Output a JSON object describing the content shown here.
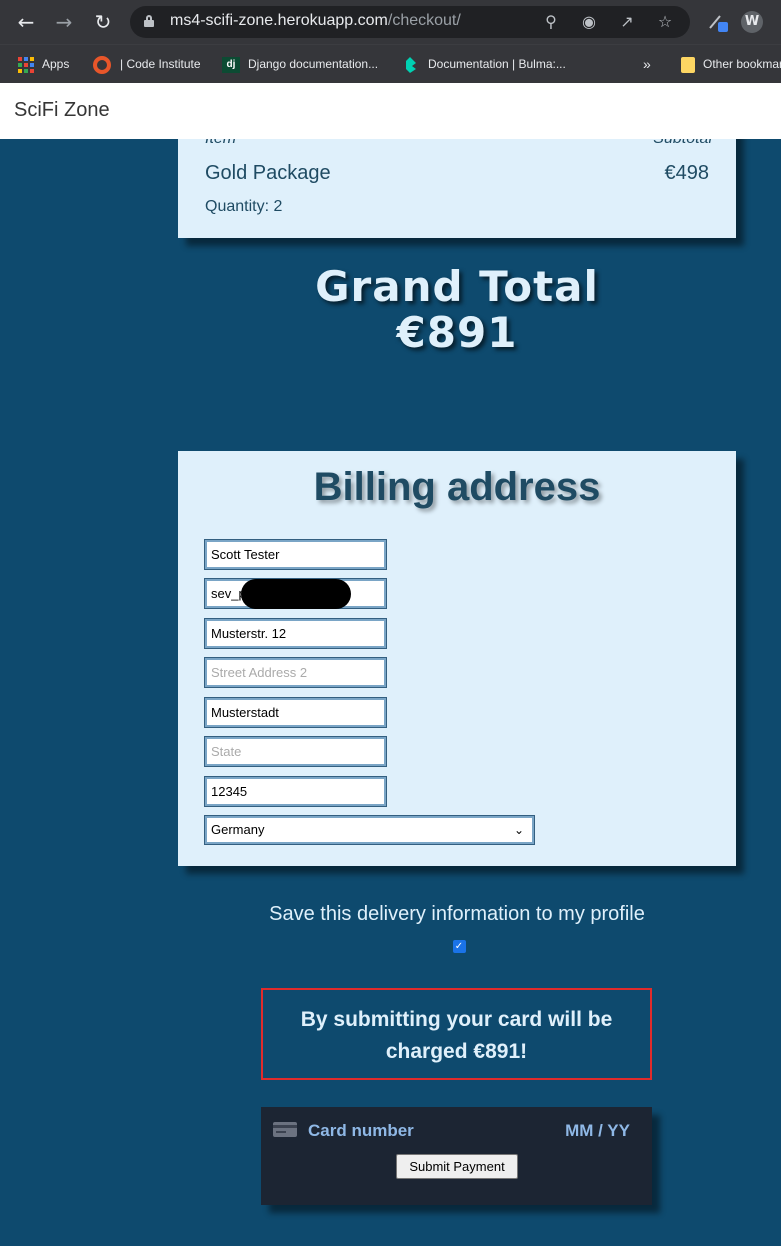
{
  "browser": {
    "url_host": "ms4-scifi-zone.herokuapp.com",
    "url_path": "/checkout/",
    "avatar_letter": "W",
    "bookmarks": [
      {
        "label": "Apps",
        "icon": "apps-grid-icon"
      },
      {
        "label": "| Code Institute",
        "icon": "code-institute-icon"
      },
      {
        "label": "Django documentation...",
        "icon": "django-icon"
      },
      {
        "label": "Documentation | Bulma:...",
        "icon": "bulma-icon"
      },
      {
        "label": "Other bookmarks",
        "icon": "folder-icon"
      }
    ],
    "overflow": "»"
  },
  "site": {
    "brand": "SciFi Zone"
  },
  "order": {
    "col_item": "Item",
    "col_subtotal": "Subtotal",
    "item_name": "Gold Package",
    "item_subtotal": "€498",
    "quantity": "Quantity: 2"
  },
  "grand_total": {
    "label": "Grand Total",
    "value": "€891"
  },
  "billing": {
    "title": "Billing address",
    "full_name": "Scott Tester",
    "email_partial": "sev_p",
    "street1": "Musterstr. 12",
    "street2_placeholder": "Street Address 2",
    "city": "Musterstadt",
    "state_placeholder": "State",
    "postcode": "12345",
    "country": "Germany"
  },
  "save_info": {
    "label": "Save this delivery information to my profile",
    "checked": true
  },
  "warning": {
    "line1": "By submitting your card will be",
    "line2": "charged €891!"
  },
  "payment": {
    "card_placeholder": "Card number",
    "expiry_placeholder": "MM / YY",
    "submit_label": "Submit Payment"
  },
  "colors": {
    "page_bg": "#0e4a6e",
    "card_bg": "#dff0fb",
    "warning_border": "#e02b2b"
  }
}
